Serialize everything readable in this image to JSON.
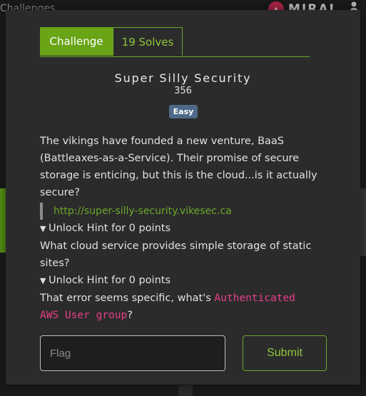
{
  "background": {
    "page_title": "Challenges",
    "logo_text": "MIRAI",
    "icons": [
      "mirai-logo-icon",
      "user-icon"
    ]
  },
  "modal": {
    "tabs": [
      {
        "label": "Challenge",
        "active": true
      },
      {
        "label": "19 Solves",
        "active": false
      }
    ],
    "title": "Super Silly Security",
    "points": "356",
    "difficulty": "Easy",
    "description": "The vikings have founded a new venture, BaaS (Battleaxes-as-a-Service). Their promise of secure storage is enticing, but this is the cloud...is it actually secure?",
    "link": "http://super-silly-security.vikesec.ca",
    "hints": [
      {
        "summary": "Unlock Hint for 0 points",
        "text": "What cloud service provides simple storage of static sites?"
      },
      {
        "summary": "Unlock Hint for 0 points",
        "text_before": "That error seems specific, what's ",
        "code": "Authenticated AWS User group",
        "text_after": "?"
      }
    ],
    "flag_placeholder": "Flag",
    "submit_label": "Submit"
  },
  "colors": {
    "accent_green": "#6aa417",
    "badge_blue": "#4e6a88",
    "code_pink": "#e83e8c",
    "modal_bg": "#2b2b2b"
  }
}
